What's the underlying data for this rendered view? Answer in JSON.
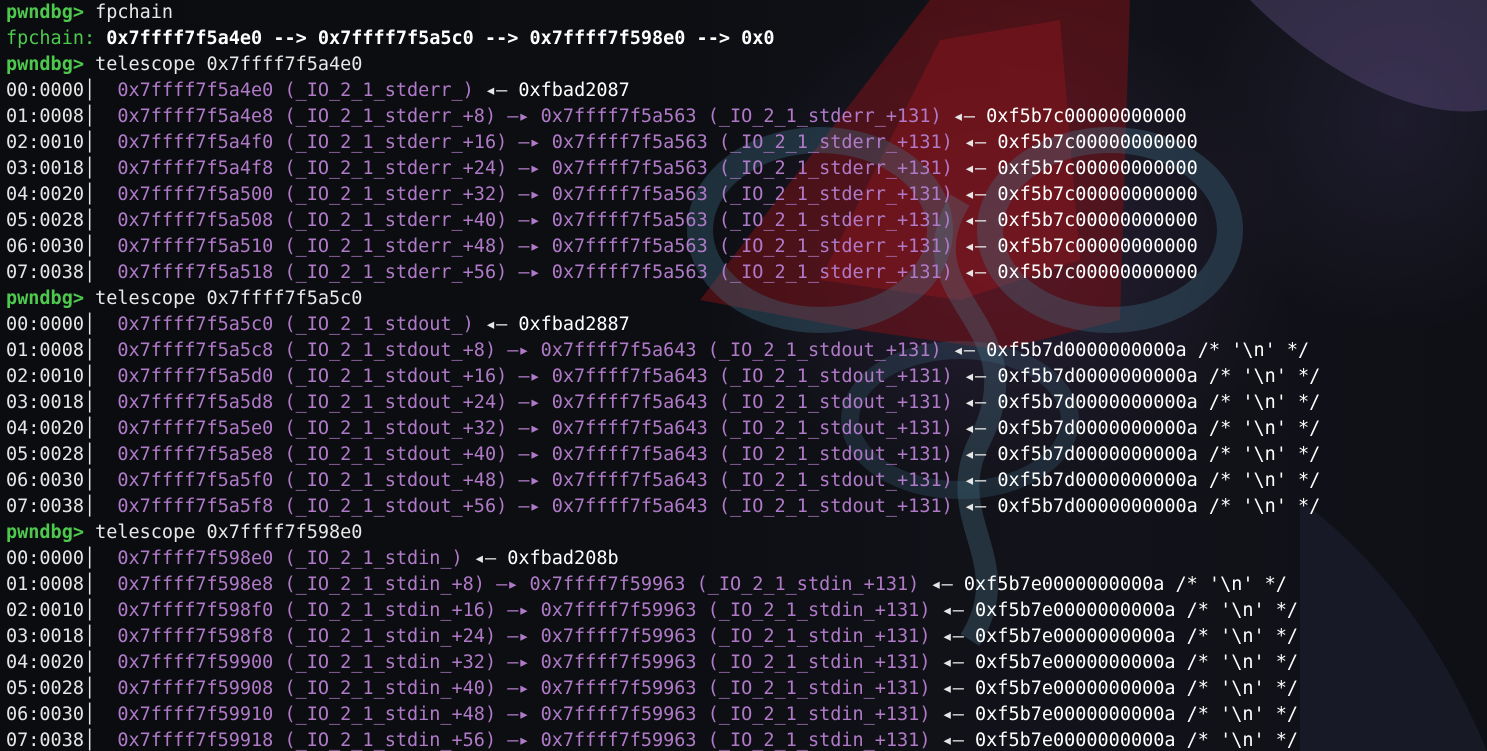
{
  "prompt": "pwndbg>",
  "line1": {
    "command": " fpchain"
  },
  "fpchain": {
    "label": "fpchain:",
    "text": " 0x7ffff7f5a4e0 --> 0x7ffff7f5a5c0 --> 0x7ffff7f598e0 --> 0x0"
  },
  "blocks": [
    {
      "command": " telescope 0x7ffff7f5a4e0",
      "rows": [
        {
          "idx": "00:0000",
          "addr": "0x7ffff7f5a4e0 (_IO_2_1_stderr_)",
          "arrow": " ◂— ",
          "val": "0xfbad2087"
        },
        {
          "idx": "01:0008",
          "addr": "0x7ffff7f5a4e8 (_IO_2_1_stderr_+8) —▸ 0x7ffff7f5a563 (_IO_2_1_stderr_+131)",
          "arrow": " ◂— ",
          "val": "0xf5b7c00000000000"
        },
        {
          "idx": "02:0010",
          "addr": "0x7ffff7f5a4f0 (_IO_2_1_stderr_+16) —▸ 0x7ffff7f5a563 (_IO_2_1_stderr_+131)",
          "arrow": " ◂— ",
          "val": "0xf5b7c00000000000"
        },
        {
          "idx": "03:0018",
          "addr": "0x7ffff7f5a4f8 (_IO_2_1_stderr_+24) —▸ 0x7ffff7f5a563 (_IO_2_1_stderr_+131)",
          "arrow": " ◂— ",
          "val": "0xf5b7c00000000000"
        },
        {
          "idx": "04:0020",
          "addr": "0x7ffff7f5a500 (_IO_2_1_stderr_+32) —▸ 0x7ffff7f5a563 (_IO_2_1_stderr_+131)",
          "arrow": " ◂— ",
          "val": "0xf5b7c00000000000"
        },
        {
          "idx": "05:0028",
          "addr": "0x7ffff7f5a508 (_IO_2_1_stderr_+40) —▸ 0x7ffff7f5a563 (_IO_2_1_stderr_+131)",
          "arrow": " ◂— ",
          "val": "0xf5b7c00000000000"
        },
        {
          "idx": "06:0030",
          "addr": "0x7ffff7f5a510 (_IO_2_1_stderr_+48) —▸ 0x7ffff7f5a563 (_IO_2_1_stderr_+131)",
          "arrow": " ◂— ",
          "val": "0xf5b7c00000000000"
        },
        {
          "idx": "07:0038",
          "addr": "0x7ffff7f5a518 (_IO_2_1_stderr_+56) —▸ 0x7ffff7f5a563 (_IO_2_1_stderr_+131)",
          "arrow": " ◂— ",
          "val": "0xf5b7c00000000000"
        }
      ]
    },
    {
      "command": " telescope 0x7ffff7f5a5c0",
      "rows": [
        {
          "idx": "00:0000",
          "addr": "0x7ffff7f5a5c0 (_IO_2_1_stdout_)",
          "arrow": " ◂— ",
          "val": "0xfbad2887"
        },
        {
          "idx": "01:0008",
          "addr": "0x7ffff7f5a5c8 (_IO_2_1_stdout_+8) —▸ 0x7ffff7f5a643 (_IO_2_1_stdout_+131)",
          "arrow": " ◂— ",
          "val": "0xf5b7d0000000000a /* '\\n' */"
        },
        {
          "idx": "02:0010",
          "addr": "0x7ffff7f5a5d0 (_IO_2_1_stdout_+16) —▸ 0x7ffff7f5a643 (_IO_2_1_stdout_+131)",
          "arrow": " ◂— ",
          "val": "0xf5b7d0000000000a /* '\\n' */"
        },
        {
          "idx": "03:0018",
          "addr": "0x7ffff7f5a5d8 (_IO_2_1_stdout_+24) —▸ 0x7ffff7f5a643 (_IO_2_1_stdout_+131)",
          "arrow": " ◂— ",
          "val": "0xf5b7d0000000000a /* '\\n' */"
        },
        {
          "idx": "04:0020",
          "addr": "0x7ffff7f5a5e0 (_IO_2_1_stdout_+32) —▸ 0x7ffff7f5a643 (_IO_2_1_stdout_+131)",
          "arrow": " ◂— ",
          "val": "0xf5b7d0000000000a /* '\\n' */"
        },
        {
          "idx": "05:0028",
          "addr": "0x7ffff7f5a5e8 (_IO_2_1_stdout_+40) —▸ 0x7ffff7f5a643 (_IO_2_1_stdout_+131)",
          "arrow": " ◂— ",
          "val": "0xf5b7d0000000000a /* '\\n' */"
        },
        {
          "idx": "06:0030",
          "addr": "0x7ffff7f5a5f0 (_IO_2_1_stdout_+48) —▸ 0x7ffff7f5a643 (_IO_2_1_stdout_+131)",
          "arrow": " ◂— ",
          "val": "0xf5b7d0000000000a /* '\\n' */"
        },
        {
          "idx": "07:0038",
          "addr": "0x7ffff7f5a5f8 (_IO_2_1_stdout_+56) —▸ 0x7ffff7f5a643 (_IO_2_1_stdout_+131)",
          "arrow": " ◂— ",
          "val": "0xf5b7d0000000000a /* '\\n' */"
        }
      ]
    },
    {
      "command": " telescope 0x7ffff7f598e0",
      "rows": [
        {
          "idx": "00:0000",
          "addr": "0x7ffff7f598e0 (_IO_2_1_stdin_)",
          "arrow": " ◂— ",
          "val": "0xfbad208b"
        },
        {
          "idx": "01:0008",
          "addr": "0x7ffff7f598e8 (_IO_2_1_stdin_+8) —▸ 0x7ffff7f59963 (_IO_2_1_stdin_+131)",
          "arrow": " ◂— ",
          "val": "0xf5b7e0000000000a /* '\\n' */"
        },
        {
          "idx": "02:0010",
          "addr": "0x7ffff7f598f0 (_IO_2_1_stdin_+16) —▸ 0x7ffff7f59963 (_IO_2_1_stdin_+131)",
          "arrow": " ◂— ",
          "val": "0xf5b7e0000000000a /* '\\n' */"
        },
        {
          "idx": "03:0018",
          "addr": "0x7ffff7f598f8 (_IO_2_1_stdin_+24) —▸ 0x7ffff7f59963 (_IO_2_1_stdin_+131)",
          "arrow": " ◂— ",
          "val": "0xf5b7e0000000000a /* '\\n' */"
        },
        {
          "idx": "04:0020",
          "addr": "0x7ffff7f59900 (_IO_2_1_stdin_+32) —▸ 0x7ffff7f59963 (_IO_2_1_stdin_+131)",
          "arrow": " ◂— ",
          "val": "0xf5b7e0000000000a /* '\\n' */"
        },
        {
          "idx": "05:0028",
          "addr": "0x7ffff7f59908 (_IO_2_1_stdin_+40) —▸ 0x7ffff7f59963 (_IO_2_1_stdin_+131)",
          "arrow": " ◂— ",
          "val": "0xf5b7e0000000000a /* '\\n' */"
        },
        {
          "idx": "06:0030",
          "addr": "0x7ffff7f59910 (_IO_2_1_stdin_+48) —▸ 0x7ffff7f59963 (_IO_2_1_stdin_+131)",
          "arrow": " ◂— ",
          "val": "0xf5b7e0000000000a /* '\\n' */"
        },
        {
          "idx": "07:0038",
          "addr": "0x7ffff7f59918 (_IO_2_1_stdin_+56) —▸ 0x7ffff7f59963 (_IO_2_1_stdin_+131)",
          "arrow": " ◂— ",
          "val": "0xf5b7e0000000000a /* '\\n' */"
        }
      ]
    }
  ],
  "separator": "│  ",
  "colors": {
    "background": "#0b0d10",
    "prompt": "#4ec94e",
    "address": "#b07ac8",
    "text": "#e6e6e6",
    "emblem": "#b0181c"
  }
}
